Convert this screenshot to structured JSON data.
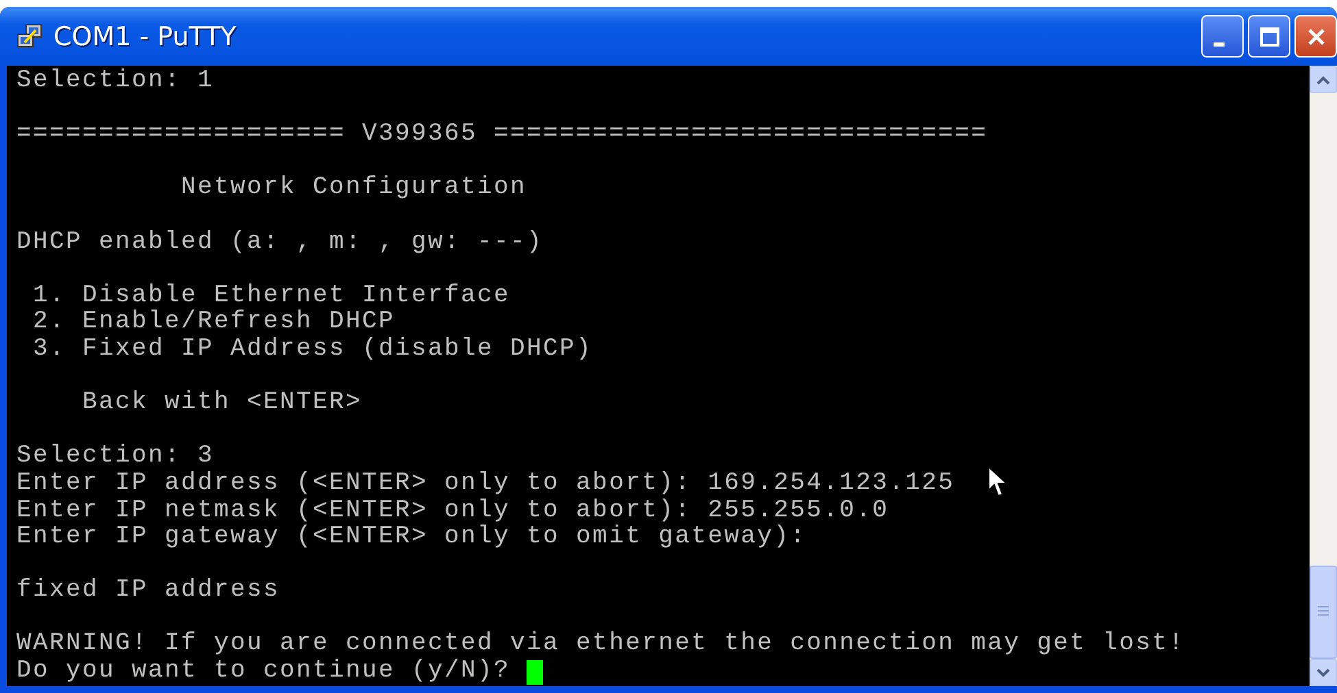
{
  "window": {
    "title": "COM1 - PuTTY"
  },
  "terminal": {
    "blocks": [
      [
        "Selection: 1"
      ],
      [
        "==================== V399365 =============================="
      ],
      [
        "          Network Configuration"
      ],
      [
        "DHCP enabled (a: , m: , gw: ---)"
      ],
      [
        " 1. Disable Ethernet Interface",
        " 2. Enable/Refresh DHCP",
        " 3. Fixed IP Address (disable DHCP)"
      ],
      [
        "    Back with <ENTER>"
      ],
      [
        "Selection: 3",
        "Enter IP address (<ENTER> only to abort): 169.254.123.125",
        "Enter IP netmask (<ENTER> only to abort): 255.255.0.0",
        "Enter IP gateway (<ENTER> only to omit gateway):"
      ],
      [
        "fixed IP address"
      ],
      [
        "WARNING! If you are connected via ethernet the connection may get lost!",
        "Do you want to continue (y/N)? "
      ]
    ]
  }
}
